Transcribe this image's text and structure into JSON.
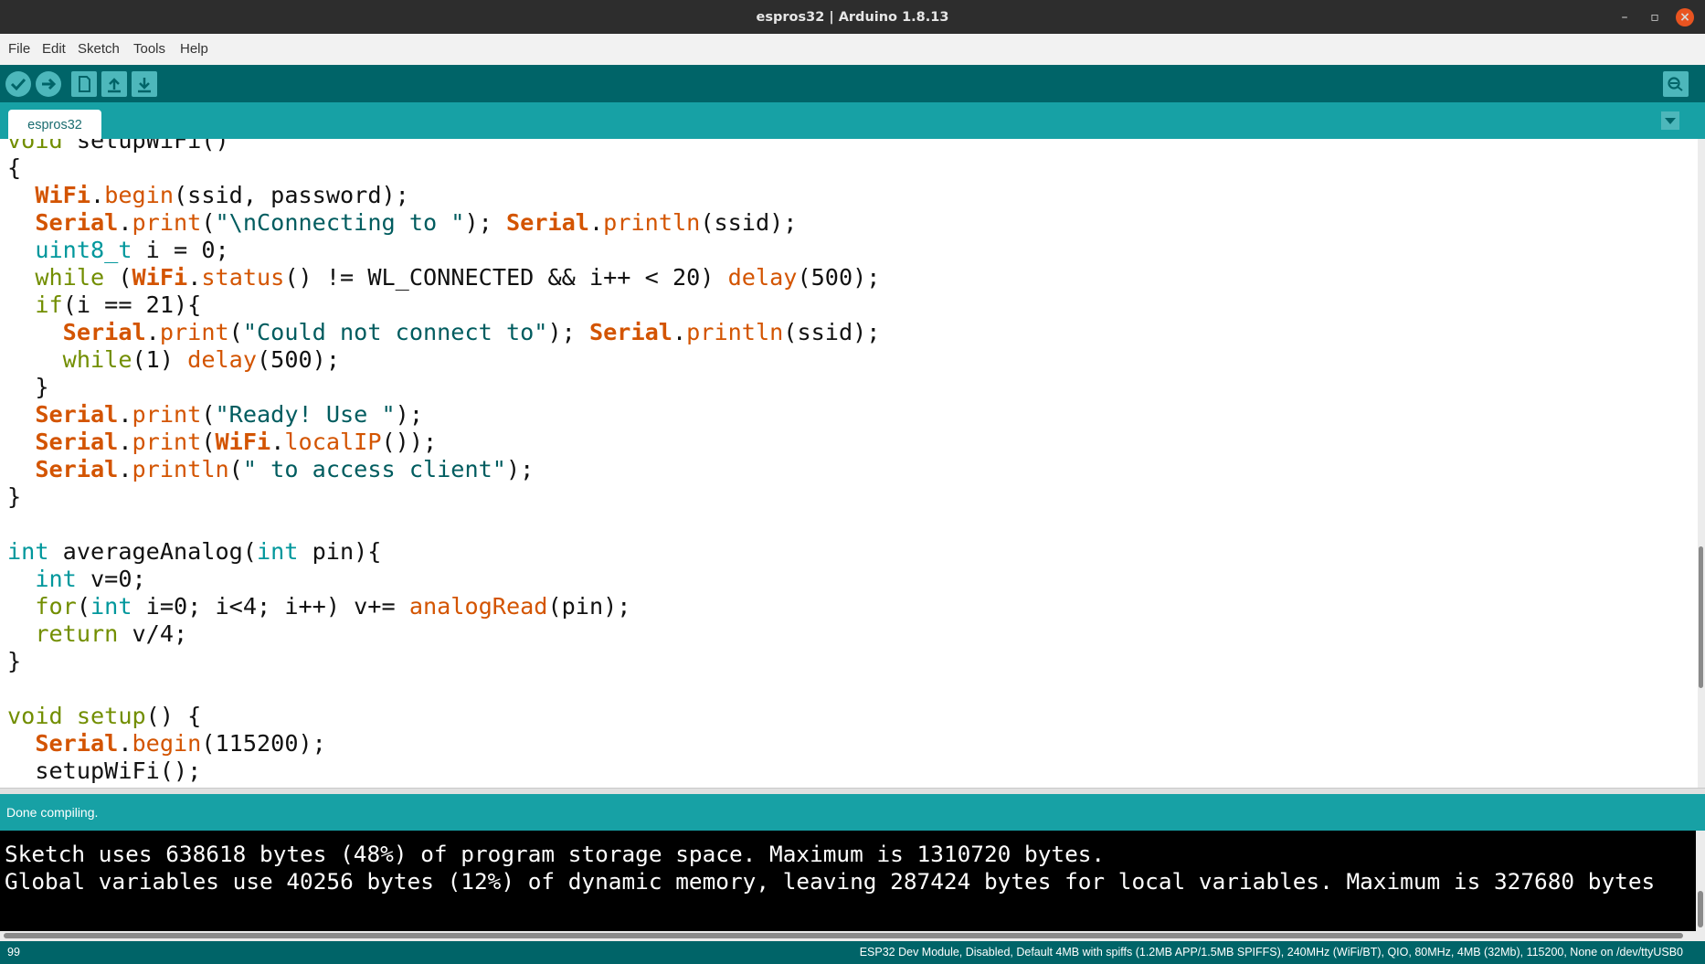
{
  "window": {
    "title": "espros32 | Arduino 1.8.13",
    "controls": [
      "–",
      "▫",
      "×"
    ]
  },
  "menu": [
    {
      "label": "File"
    },
    {
      "label": "Edit"
    },
    {
      "label": "Sketch"
    },
    {
      "label": "Tools"
    },
    {
      "label": "Help"
    }
  ],
  "toolbar": {
    "buttons": [
      {
        "name": "verify",
        "icon": "checkmark-icon"
      },
      {
        "name": "upload",
        "icon": "arrow-right-icon"
      },
      {
        "name": "new",
        "icon": "new-file-icon"
      },
      {
        "name": "open",
        "icon": "open-up-arrow-icon"
      },
      {
        "name": "save",
        "icon": "save-down-arrow-icon"
      }
    ],
    "serial_monitor_icon": "magnifier-icon"
  },
  "tabs": [
    {
      "label": "espros32",
      "active": true
    }
  ],
  "editor": {
    "lines": [
      [
        {
          "t": "void ",
          "c": "kw"
        },
        {
          "t": "setupWiFi()",
          "c": ""
        }
      ],
      [
        {
          "t": "{",
          "c": ""
        }
      ],
      [
        {
          "t": "  ",
          "c": ""
        },
        {
          "t": "WiFi",
          "c": "obj"
        },
        {
          "t": ".",
          "c": ""
        },
        {
          "t": "begin",
          "c": "fn"
        },
        {
          "t": "(ssid, password);",
          "c": ""
        }
      ],
      [
        {
          "t": "  ",
          "c": ""
        },
        {
          "t": "Serial",
          "c": "obj"
        },
        {
          "t": ".",
          "c": ""
        },
        {
          "t": "print",
          "c": "fn"
        },
        {
          "t": "(",
          "c": ""
        },
        {
          "t": "\"\\nConnecting to \"",
          "c": "str"
        },
        {
          "t": "); ",
          "c": ""
        },
        {
          "t": "Serial",
          "c": "obj"
        },
        {
          "t": ".",
          "c": ""
        },
        {
          "t": "println",
          "c": "fn"
        },
        {
          "t": "(ssid);",
          "c": ""
        }
      ],
      [
        {
          "t": "  ",
          "c": ""
        },
        {
          "t": "uint8_t",
          "c": "ty"
        },
        {
          "t": " i = 0;",
          "c": ""
        }
      ],
      [
        {
          "t": "  ",
          "c": ""
        },
        {
          "t": "while",
          "c": "kw"
        },
        {
          "t": " (",
          "c": ""
        },
        {
          "t": "WiFi",
          "c": "obj"
        },
        {
          "t": ".",
          "c": ""
        },
        {
          "t": "status",
          "c": "fn"
        },
        {
          "t": "() != WL_CONNECTED && i++ < 20) ",
          "c": ""
        },
        {
          "t": "delay",
          "c": "fn"
        },
        {
          "t": "(500);",
          "c": ""
        }
      ],
      [
        {
          "t": "  ",
          "c": ""
        },
        {
          "t": "if",
          "c": "kw"
        },
        {
          "t": "(i == 21){",
          "c": ""
        }
      ],
      [
        {
          "t": "    ",
          "c": ""
        },
        {
          "t": "Serial",
          "c": "obj"
        },
        {
          "t": ".",
          "c": ""
        },
        {
          "t": "print",
          "c": "fn"
        },
        {
          "t": "(",
          "c": ""
        },
        {
          "t": "\"Could not connect to\"",
          "c": "str"
        },
        {
          "t": "); ",
          "c": ""
        },
        {
          "t": "Serial",
          "c": "obj"
        },
        {
          "t": ".",
          "c": ""
        },
        {
          "t": "println",
          "c": "fn"
        },
        {
          "t": "(ssid);",
          "c": ""
        }
      ],
      [
        {
          "t": "    ",
          "c": ""
        },
        {
          "t": "while",
          "c": "kw"
        },
        {
          "t": "(1) ",
          "c": ""
        },
        {
          "t": "delay",
          "c": "fn"
        },
        {
          "t": "(500);",
          "c": ""
        }
      ],
      [
        {
          "t": "  }",
          "c": ""
        }
      ],
      [
        {
          "t": "  ",
          "c": ""
        },
        {
          "t": "Serial",
          "c": "obj"
        },
        {
          "t": ".",
          "c": ""
        },
        {
          "t": "print",
          "c": "fn"
        },
        {
          "t": "(",
          "c": ""
        },
        {
          "t": "\"Ready! Use \"",
          "c": "str"
        },
        {
          "t": ");",
          "c": ""
        }
      ],
      [
        {
          "t": "  ",
          "c": ""
        },
        {
          "t": "Serial",
          "c": "obj"
        },
        {
          "t": ".",
          "c": ""
        },
        {
          "t": "print",
          "c": "fn"
        },
        {
          "t": "(",
          "c": ""
        },
        {
          "t": "WiFi",
          "c": "obj"
        },
        {
          "t": ".",
          "c": ""
        },
        {
          "t": "localIP",
          "c": "fn"
        },
        {
          "t": "());",
          "c": ""
        }
      ],
      [
        {
          "t": "  ",
          "c": ""
        },
        {
          "t": "Serial",
          "c": "obj"
        },
        {
          "t": ".",
          "c": ""
        },
        {
          "t": "println",
          "c": "fn"
        },
        {
          "t": "(",
          "c": ""
        },
        {
          "t": "\" to access client\"",
          "c": "str"
        },
        {
          "t": ");",
          "c": ""
        }
      ],
      [
        {
          "t": "}",
          "c": ""
        }
      ],
      [
        {
          "t": "",
          "c": ""
        }
      ],
      [
        {
          "t": "int",
          "c": "ty"
        },
        {
          "t": " averageAnalog(",
          "c": ""
        },
        {
          "t": "int",
          "c": "ty"
        },
        {
          "t": " pin){",
          "c": ""
        }
      ],
      [
        {
          "t": "  ",
          "c": ""
        },
        {
          "t": "int",
          "c": "ty"
        },
        {
          "t": " v=0;",
          "c": ""
        }
      ],
      [
        {
          "t": "  ",
          "c": ""
        },
        {
          "t": "for",
          "c": "kw"
        },
        {
          "t": "(",
          "c": ""
        },
        {
          "t": "int",
          "c": "ty"
        },
        {
          "t": " i=0; i<4; i++) v+= ",
          "c": ""
        },
        {
          "t": "analogRead",
          "c": "fn"
        },
        {
          "t": "(pin);",
          "c": ""
        }
      ],
      [
        {
          "t": "  ",
          "c": ""
        },
        {
          "t": "return",
          "c": "kw"
        },
        {
          "t": " v/4;",
          "c": ""
        }
      ],
      [
        {
          "t": "}",
          "c": ""
        }
      ],
      [
        {
          "t": "",
          "c": ""
        }
      ],
      [
        {
          "t": "void",
          "c": "kw"
        },
        {
          "t": " ",
          "c": ""
        },
        {
          "t": "setup",
          "c": "kw"
        },
        {
          "t": "() {",
          "c": ""
        }
      ],
      [
        {
          "t": "  ",
          "c": ""
        },
        {
          "t": "Serial",
          "c": "obj"
        },
        {
          "t": ".",
          "c": ""
        },
        {
          "t": "begin",
          "c": "fn"
        },
        {
          "t": "(115200);",
          "c": ""
        }
      ],
      [
        {
          "t": "  setupWiFi();",
          "c": ""
        }
      ]
    ]
  },
  "status_message": "Done compiling.",
  "console": {
    "lines": [
      "Sketch uses 638618 bytes (48%) of program storage space. Maximum is 1310720 bytes.",
      "Global variables use 40256 bytes (12%) of dynamic memory, leaving 287424 bytes for local variables. Maximum is 327680 bytes"
    ]
  },
  "statusbar": {
    "line_number": "99",
    "board_info": "ESP32 Dev Module, Disabled, Default 4MB with spiffs (1.2MB APP/1.5MB SPIFFS), 240MHz (WiFi/BT), QIO, 80MHz, 4MB (32Mb), 115200, None on /dev/ttyUSB0"
  },
  "colors": {
    "toolbar": "#006468",
    "tabbar": "#17a1a5",
    "keyword": "#728e00",
    "type": "#00979c",
    "object": "#d35400",
    "string": "#005c5f"
  }
}
